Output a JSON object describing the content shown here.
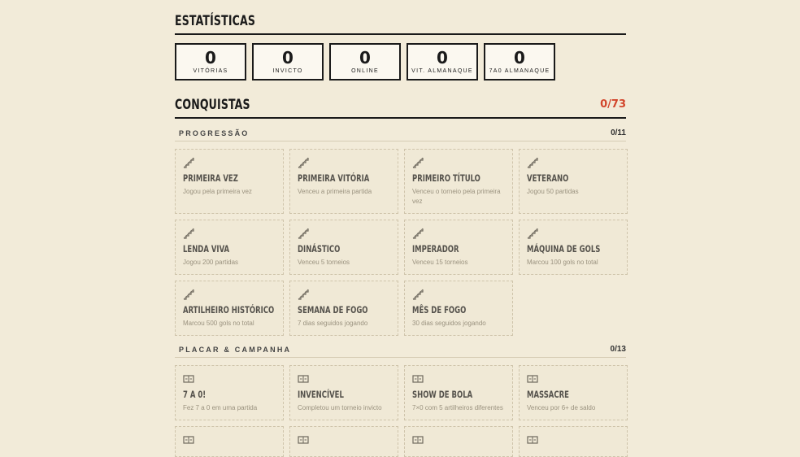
{
  "stats": {
    "title": "ESTATÍSTICAS",
    "items": [
      {
        "value": "0",
        "label": "VITÓRIAS"
      },
      {
        "value": "0",
        "label": "INVICTO"
      },
      {
        "value": "0",
        "label": "ONLINE"
      },
      {
        "value": "0",
        "label": "VIT. ALMANAQUE"
      },
      {
        "value": "0",
        "label": "7A0 ALMANAQUE"
      }
    ]
  },
  "achievements": {
    "title": "CONQUISTAS",
    "count": "0/73",
    "accent_color": "#d2452b",
    "categories": [
      {
        "title": "PROGRESSÃO",
        "count": "0/11",
        "icon": "stairs-icon",
        "items": [
          {
            "title": "PRIMEIRA VEZ",
            "desc": "Jogou pela primeira vez"
          },
          {
            "title": "PRIMEIRA VITÓRIA",
            "desc": "Venceu a primeira partida"
          },
          {
            "title": "PRIMEIRO TÍTULO",
            "desc": "Venceu o torneio pela primeira vez"
          },
          {
            "title": "VETERANO",
            "desc": "Jogou 50 partidas"
          },
          {
            "title": "LENDA VIVA",
            "desc": "Jogou 200 partidas"
          },
          {
            "title": "DINÁSTICO",
            "desc": "Venceu 5 torneios"
          },
          {
            "title": "IMPERADOR",
            "desc": "Venceu 15 torneios"
          },
          {
            "title": "MÁQUINA DE GOLS",
            "desc": "Marcou 100 gols no total"
          },
          {
            "title": "ARTILHEIRO HISTÓRICO",
            "desc": "Marcou 500 gols no total"
          },
          {
            "title": "SEMANA DE FOGO",
            "desc": "7 dias seguidos jogando"
          },
          {
            "title": "MÊS DE FOGO",
            "desc": "30 dias seguidos jogando"
          }
        ]
      },
      {
        "title": "PLACAR & CAMPANHA",
        "count": "0/13",
        "icon": "scoreboard-icon",
        "items": [
          {
            "title": "7 A 0!",
            "desc": "Fez 7 a 0 em uma partida"
          },
          {
            "title": "INVENCÍVEL",
            "desc": "Completou um torneio invicto"
          },
          {
            "title": "SHOW DE BOLA",
            "desc": "7×0 com 5 artilheiros diferentes"
          },
          {
            "title": "MASSACRE",
            "desc": "Venceu por 6+ de saldo"
          },
          {
            "title": "",
            "desc": ""
          },
          {
            "title": "",
            "desc": ""
          },
          {
            "title": "",
            "desc": ""
          },
          {
            "title": "",
            "desc": ""
          }
        ]
      }
    ]
  }
}
